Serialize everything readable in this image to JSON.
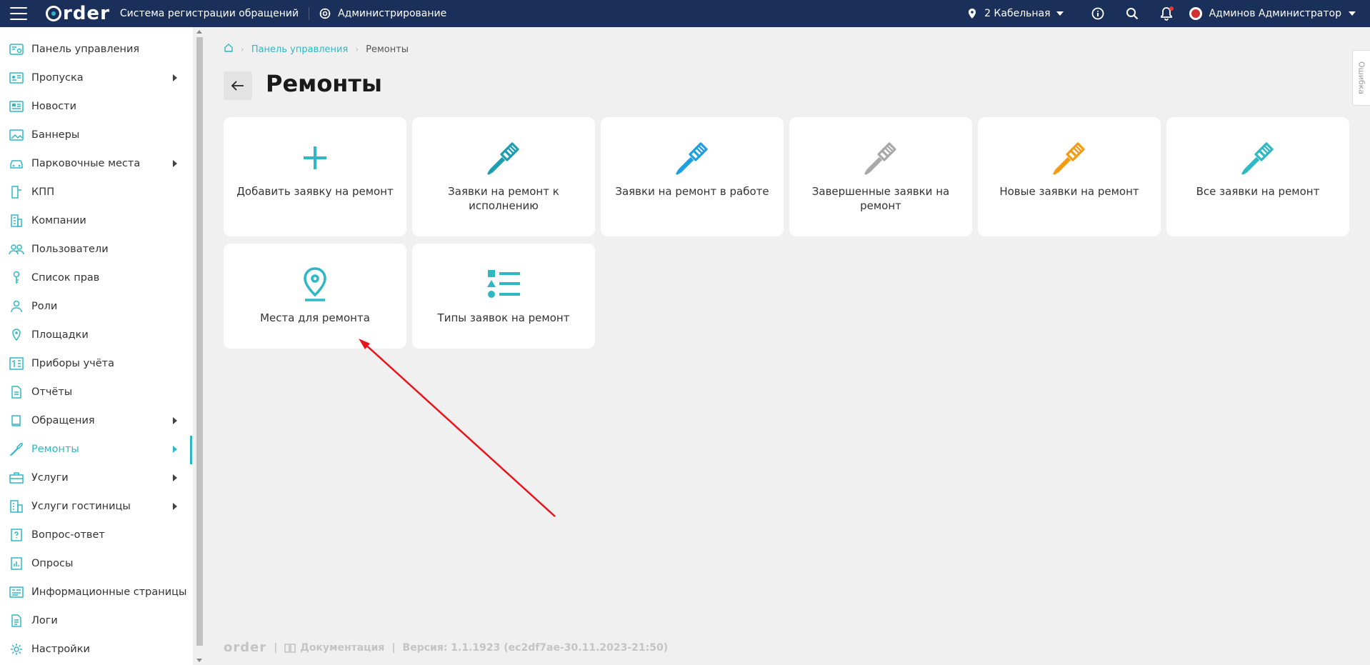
{
  "header": {
    "logo_text": "rder",
    "app_title": "Система регистрации обращений",
    "admin_label": "Администрирование",
    "location": "2 Кабельная",
    "user_name": "Админов Администратор"
  },
  "sidebar": {
    "items": [
      {
        "label": "Панель управления",
        "icon": "dashboard-icon",
        "submenu": false
      },
      {
        "label": "Пропуска",
        "icon": "badge-icon",
        "submenu": true
      },
      {
        "label": "Новости",
        "icon": "news-icon",
        "submenu": false
      },
      {
        "label": "Баннеры",
        "icon": "banner-icon",
        "submenu": false
      },
      {
        "label": "Парковочные места",
        "icon": "car-icon",
        "submenu": true
      },
      {
        "label": "КПП",
        "icon": "checkpoint-icon",
        "submenu": false
      },
      {
        "label": "Компании",
        "icon": "building-icon",
        "submenu": false
      },
      {
        "label": "Пользователи",
        "icon": "users-icon",
        "submenu": false
      },
      {
        "label": "Список прав",
        "icon": "key-icon",
        "submenu": false
      },
      {
        "label": "Роли",
        "icon": "user-icon",
        "submenu": false
      },
      {
        "label": "Площадки",
        "icon": "location-icon",
        "submenu": false
      },
      {
        "label": "Приборы учёта",
        "icon": "meter-icon",
        "submenu": false
      },
      {
        "label": "Отчёты",
        "icon": "report-icon",
        "submenu": false
      },
      {
        "label": "Обращения",
        "icon": "book-icon",
        "submenu": true
      },
      {
        "label": "Ремонты",
        "icon": "screwdriver-icon",
        "submenu": true,
        "active": true
      },
      {
        "label": "Услуги",
        "icon": "briefcase-icon",
        "submenu": true
      },
      {
        "label": "Услуги гостиницы",
        "icon": "hotel-icon",
        "submenu": true
      },
      {
        "label": "Вопрос-ответ",
        "icon": "faq-icon",
        "submenu": false
      },
      {
        "label": "Опросы",
        "icon": "poll-icon",
        "submenu": false
      },
      {
        "label": "Информационные страницы",
        "icon": "info-page-icon",
        "submenu": false
      },
      {
        "label": "Логи",
        "icon": "log-icon",
        "submenu": false
      },
      {
        "label": "Настройки",
        "icon": "settings-icon",
        "submenu": false
      }
    ]
  },
  "breadcrumb": {
    "items": [
      "Панель управления",
      "Ремонты"
    ]
  },
  "page": {
    "title": "Ремонты"
  },
  "cards": [
    {
      "label": "Добавить заявку на ремонт",
      "icon": "plus-icon",
      "color": "#2eb8c4"
    },
    {
      "label": "Заявки на ремонт к исполнению",
      "icon": "screwdriver-icon",
      "color": "#1e9cb0"
    },
    {
      "label": "Заявки на ремонт в работе",
      "icon": "screwdriver-icon",
      "color": "#1e9fe0"
    },
    {
      "label": "Завершенные заявки на ремонт",
      "icon": "screwdriver-icon",
      "color": "#a8a8a8"
    },
    {
      "label": "Новые заявки на ремонт",
      "icon": "screwdriver-icon",
      "color": "#f39c12"
    },
    {
      "label": "Все заявки на ремонт",
      "icon": "screwdriver-icon",
      "color": "#2eb8c4"
    },
    {
      "label": "Места для ремонта",
      "icon": "location-pin-icon",
      "color": "#2eb8c4"
    },
    {
      "label": "Типы заявок на ремонт",
      "icon": "list-types-icon",
      "color": "#2eb8c4"
    }
  ],
  "footer": {
    "logo_text": "order",
    "docs_label": "Документация",
    "version": "Версия: 1.1.1923 (ec2df7ae-30.11.2023-21:50)"
  },
  "feedback_label": "Ошибка",
  "colors": {
    "header_bg": "#1a2f5a",
    "accent": "#2eb8c4",
    "annotation_arrow": "#e8141a"
  }
}
